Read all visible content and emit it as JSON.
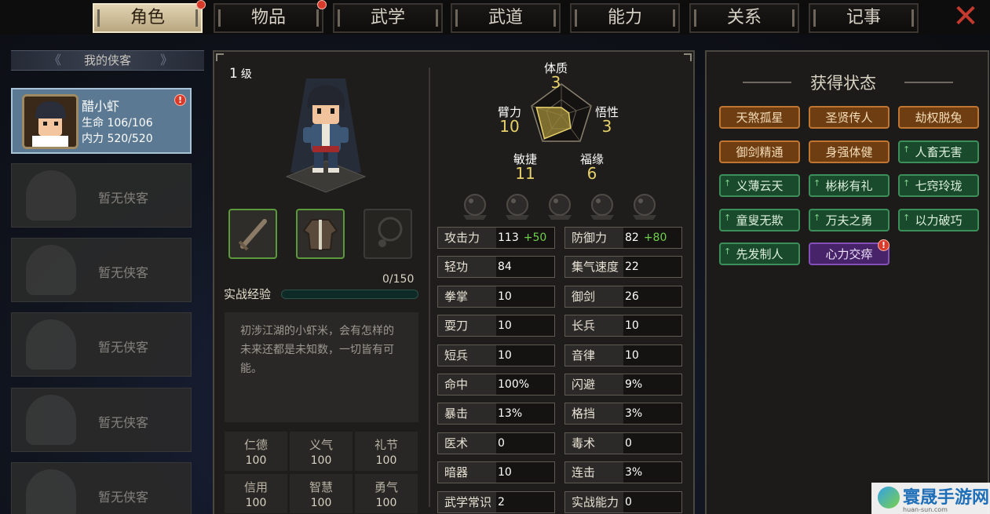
{
  "tabs": [
    {
      "label": "角色",
      "active": true,
      "alert": true
    },
    {
      "label": "物品",
      "active": false,
      "alert": true
    },
    {
      "label": "武学",
      "active": false,
      "alert": false
    },
    {
      "label": "武道",
      "active": false,
      "alert": false
    },
    {
      "label": "能力",
      "active": false,
      "alert": false
    },
    {
      "label": "关系",
      "active": false,
      "alert": false
    },
    {
      "label": "记事",
      "active": false,
      "alert": false
    }
  ],
  "close_icon": "close-x-icon",
  "roster": {
    "title": "我的侠客",
    "hero": {
      "name": "醋小虾",
      "hp_label": "生命",
      "hp": "106/106",
      "mp_label": "内力",
      "mp": "520/520",
      "alert": "!"
    },
    "empty_label": "暂无侠客"
  },
  "character": {
    "level_num": "1",
    "level_unit": "级",
    "exp_label": "实战经验",
    "exp_value": "0/150",
    "exp_fraction": 0,
    "description": "初涉江湖的小虾米，会有怎样的未来还都是未知数，一切皆有可能。",
    "equipment": [
      {
        "name": "sword-icon",
        "filled": true
      },
      {
        "name": "robe-icon",
        "filled": true
      },
      {
        "name": "necklace-icon",
        "filled": false
      }
    ],
    "virtues": [
      {
        "label": "仁德",
        "value": "100"
      },
      {
        "label": "义气",
        "value": "100"
      },
      {
        "label": "礼节",
        "value": "100"
      },
      {
        "label": "信用",
        "value": "100"
      },
      {
        "label": "智慧",
        "value": "100"
      },
      {
        "label": "勇气",
        "value": "100"
      }
    ]
  },
  "radar": {
    "attributes": [
      {
        "label": "体质",
        "value": 3
      },
      {
        "label": "悟性",
        "value": 3
      },
      {
        "label": "福缘",
        "value": 6
      },
      {
        "label": "敏捷",
        "value": 11
      },
      {
        "label": "臂力",
        "value": 10
      }
    ],
    "vals": {
      "tizhi": "3",
      "wuxing": "3",
      "fuyuan": "6",
      "minjie": "11",
      "bili": "10"
    }
  },
  "stats_left": [
    {
      "label": "攻击力",
      "value": "113",
      "bonus": "+50"
    },
    {
      "label": "轻功",
      "value": "84"
    },
    {
      "label": "拳掌",
      "value": "10"
    },
    {
      "label": "耍刀",
      "value": "10"
    },
    {
      "label": "短兵",
      "value": "10"
    },
    {
      "label": "命中",
      "value": "100%"
    },
    {
      "label": "暴击",
      "value": "13%"
    },
    {
      "label": "医术",
      "value": "0"
    },
    {
      "label": "暗器",
      "value": "10"
    },
    {
      "label": "武学常识",
      "value": "2"
    }
  ],
  "stats_right": [
    {
      "label": "防御力",
      "value": "82",
      "bonus": "+80"
    },
    {
      "label": "集气速度",
      "value": "22"
    },
    {
      "label": "御剑",
      "value": "26"
    },
    {
      "label": "长兵",
      "value": "10"
    },
    {
      "label": "音律",
      "value": "10"
    },
    {
      "label": "闪避",
      "value": "9%"
    },
    {
      "label": "格挡",
      "value": "3%"
    },
    {
      "label": "毒术",
      "value": "0"
    },
    {
      "label": "连击",
      "value": "3%"
    },
    {
      "label": "实战能力",
      "value": "0"
    }
  ],
  "status": {
    "title": "获得状态",
    "badges": [
      {
        "label": "天煞孤星",
        "kind": "o",
        "up": false
      },
      {
        "label": "圣贤传人",
        "kind": "o",
        "up": false
      },
      {
        "label": "劫权脱兔",
        "kind": "o",
        "up": false
      },
      {
        "label": "御剑精通",
        "kind": "o",
        "up": false
      },
      {
        "label": "身强体健",
        "kind": "o",
        "up": false
      },
      {
        "label": "人畜无害",
        "kind": "g",
        "up": true
      },
      {
        "label": "义薄云天",
        "kind": "g",
        "up": true
      },
      {
        "label": "彬彬有礼",
        "kind": "g",
        "up": true
      },
      {
        "label": "七窍玲珑",
        "kind": "g",
        "up": true
      },
      {
        "label": "童叟无欺",
        "kind": "g",
        "up": true
      },
      {
        "label": "万夫之勇",
        "kind": "g",
        "up": true
      },
      {
        "label": "以力破巧",
        "kind": "g",
        "up": true
      },
      {
        "label": "先发制人",
        "kind": "g",
        "up": true
      },
      {
        "label": "心力交瘁",
        "kind": "p",
        "up": false,
        "alert": true
      }
    ]
  },
  "watermark": {
    "text": "寰晟手游网",
    "sub": "huan-sun.com"
  },
  "colors": {
    "accent_gold": "#e6d06a",
    "bonus_green": "#6fd04a",
    "alert_red": "#d93b2b"
  }
}
